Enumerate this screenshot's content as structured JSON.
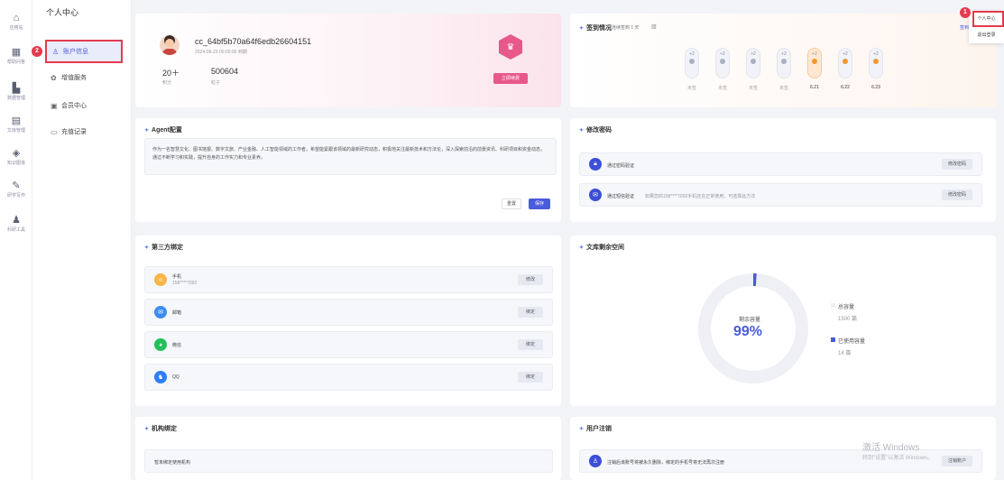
{
  "rail": [
    {
      "icon": "home-icon",
      "glyph": "⌂",
      "label": "应用站"
    },
    {
      "icon": "table-icon",
      "glyph": "▦",
      "label": "帮助问答"
    },
    {
      "icon": "chart-icon",
      "glyph": "▙",
      "label": "数据管理"
    },
    {
      "icon": "doc-icon",
      "glyph": "▤",
      "label": "文库管理"
    },
    {
      "icon": "tag-icon",
      "glyph": "◈",
      "label": "知识图谱"
    },
    {
      "icon": "pen-icon",
      "glyph": "✎",
      "label": "研学写作"
    },
    {
      "icon": "tool-icon",
      "glyph": "♟",
      "label": "科研工具"
    }
  ],
  "submenu": {
    "title": "个人中心",
    "items": [
      {
        "icon": "user-icon",
        "glyph": "♙",
        "label": "账户信息"
      },
      {
        "icon": "service-icon",
        "glyph": "✿",
        "label": "增值服务"
      },
      {
        "icon": "vip-icon",
        "glyph": "▣",
        "label": "会员中心"
      },
      {
        "icon": "card-icon",
        "glyph": "▭",
        "label": "充值记录"
      }
    ]
  },
  "profile": {
    "username": "cc_64bf5b70a64f6edb26604151",
    "date": "2024-06-23 00:00:00 到期",
    "stats": [
      {
        "value": "20＋",
        "label": "积分"
      },
      {
        "value": "500604",
        "label": "粒子"
      }
    ],
    "vip_button": "立即续费"
  },
  "signin": {
    "title": "签到情况",
    "status": "已连续签到 1 天",
    "calendar_icon": "calendar-icon",
    "rule_link": "签到规则",
    "days": [
      {
        "pts": "+2",
        "label": "未签",
        "state": "none"
      },
      {
        "pts": "+2",
        "label": "未签",
        "state": "none"
      },
      {
        "pts": "+2",
        "label": "未签",
        "state": "none"
      },
      {
        "pts": "+2",
        "label": "未签",
        "state": "none"
      },
      {
        "pts": "+2",
        "label": "6.21",
        "state": "today"
      },
      {
        "pts": "+2",
        "label": "6.22",
        "state": "ok"
      },
      {
        "pts": "+2",
        "label": "6.23",
        "state": "ok"
      }
    ]
  },
  "agent": {
    "title": "Agent配置",
    "text": "作为一名智慧文化、图书馆报、数字文旅、产业金融、人工智能领域的工作者，希望能紧跟该领域的最新研究动态，积极地关注最新技术和方法论，深入探索前沿的前景资讯、科研项目和资金动态，通过不断学习和实践，提升自身的工作实力和专业素养。",
    "reset": "重置",
    "save": "保存"
  },
  "password": {
    "title": "修改密码",
    "rows": [
      {
        "icon": "lock-icon",
        "text": "通过密码验证",
        "sub": "",
        "button": "修改密码"
      },
      {
        "icon": "message-icon",
        "text": "通过短信验证",
        "sub": "如果您的158****7092手机还在正常使用，可选择此方法",
        "button": "修改密码"
      }
    ]
  },
  "bind": {
    "title": "第三方绑定",
    "rows": [
      {
        "icon": "phone-icon",
        "text": "手机",
        "sub": "158****7092",
        "button": "修改",
        "color": "#f7b548"
      },
      {
        "icon": "email-icon",
        "text": "邮箱",
        "sub": "",
        "button": "绑定",
        "color": "#3c8cf0"
      },
      {
        "icon": "wechat-icon",
        "text": "微信",
        "sub": "",
        "button": "绑定",
        "color": "#22c05b"
      },
      {
        "icon": "qq-icon",
        "text": "QQ",
        "sub": "",
        "button": "绑定",
        "color": "#2e7df6"
      }
    ]
  },
  "storage": {
    "title": "文库剩余空间",
    "center_label": "剩余容量",
    "percent_text": "99%",
    "percent": 99,
    "total_label": "总容量",
    "total_value": "1500 篇",
    "used_label": "已使用容量",
    "used_value": "14 篇"
  },
  "org": {
    "title": "机构绑定",
    "text": "暂未绑定使用机构"
  },
  "logout": {
    "title": "用户注销",
    "text": "注销后该账号将被永久删除，绑定的手机号将无法再次注册",
    "button": "注销账户",
    "icon": "user-x-icon"
  },
  "topmenu": {
    "items": [
      "个人中心",
      "退出登录"
    ]
  },
  "watermark": {
    "line1": "激活 Windows",
    "line2": "转到\"设置\"以激活 Windows。"
  },
  "badges": {
    "one": "1",
    "two": "2"
  },
  "colors": {
    "accent": "#4a5bdc",
    "pink": "#e8588a",
    "orange": "#f19a2e",
    "highlight": "#e53a4d"
  }
}
